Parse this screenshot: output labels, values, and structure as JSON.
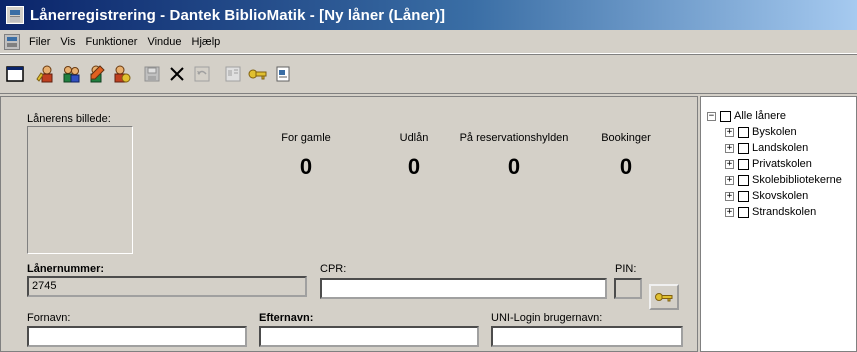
{
  "window": {
    "title": "Lånerregistrering - Dantek BiblioMatik - [Ny låner (Låner)]"
  },
  "menu": {
    "items": [
      "Filer",
      "Vis",
      "Funktioner",
      "Vindue",
      "Hjælp"
    ]
  },
  "toolbar": {
    "icons": [
      "window-icon",
      "add-user-icon",
      "users-icon",
      "user-edit-icon",
      "user-delete-icon",
      "save-icon",
      "delete-icon",
      "undo-icon",
      "properties-icon",
      "key-icon",
      "report-icon"
    ]
  },
  "photo": {
    "label": "Lånerens billede:"
  },
  "stats": [
    {
      "label": "For gamle",
      "value": "0"
    },
    {
      "label": "Udlån",
      "value": "0"
    },
    {
      "label": "På reservationshylden",
      "value": "0"
    },
    {
      "label": "Bookinger",
      "value": "0"
    }
  ],
  "form": {
    "lanernummer_label": "Lånernummer:",
    "lanernummer_value": "2745",
    "cpr_label": "CPR:",
    "cpr_value": "",
    "pin_label": "PIN:",
    "pin_value": "",
    "fornavn_label": "Fornavn:",
    "fornavn_value": "",
    "efternavn_label": "Efternavn:",
    "efternavn_value": "",
    "uni_label": "UNI-Login brugernavn:",
    "uni_value": ""
  },
  "tree": {
    "root": {
      "label": "Alle lånere",
      "expander": "−"
    },
    "children": [
      {
        "label": "Byskolen",
        "expander": "+"
      },
      {
        "label": "Landskolen",
        "expander": "+"
      },
      {
        "label": "Privatskolen",
        "expander": "+"
      },
      {
        "label": "Skolebibliotekerne",
        "expander": "+"
      },
      {
        "label": "Skovskolen",
        "expander": "+"
      },
      {
        "label": "Strandskolen",
        "expander": "+"
      }
    ]
  },
  "colors": {
    "title_start": "#0a246a",
    "title_end": "#a6caf0",
    "face": "#d4d0c8"
  }
}
